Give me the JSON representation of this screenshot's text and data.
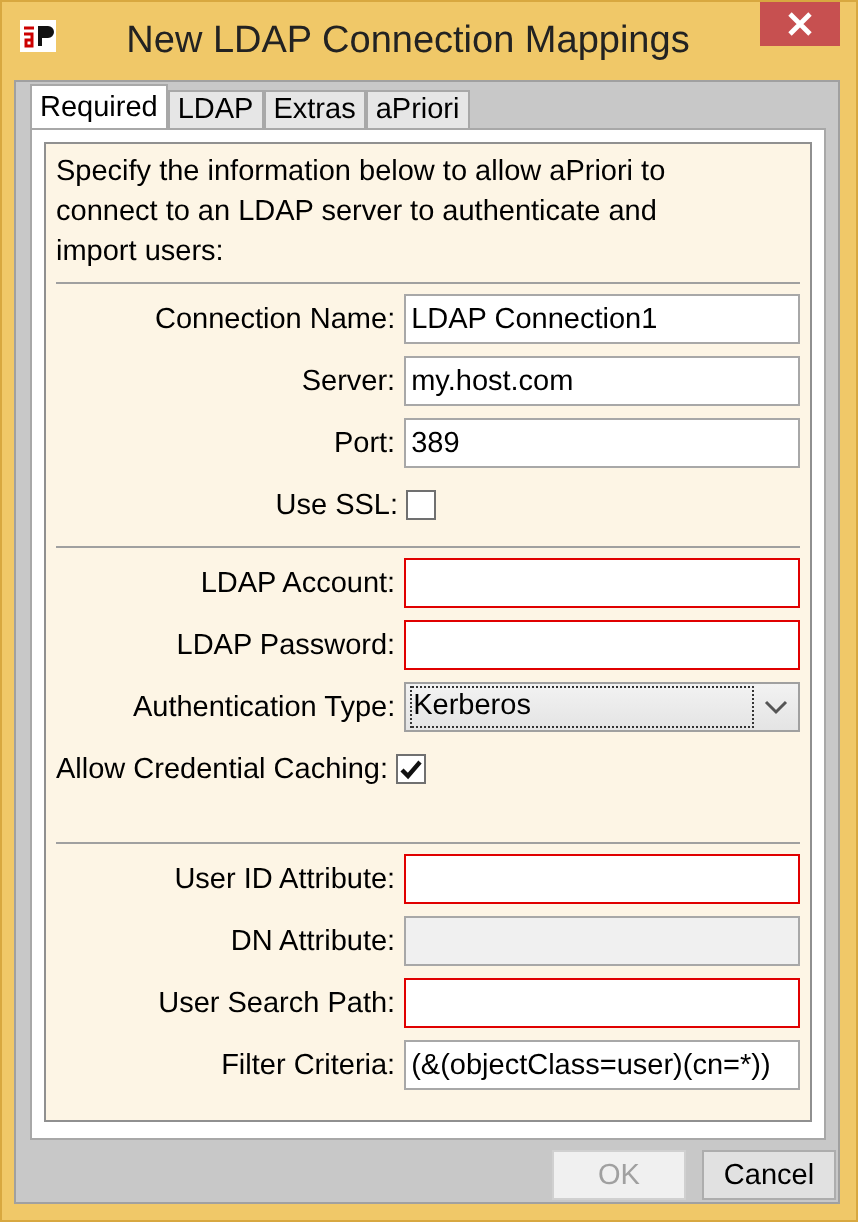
{
  "window": {
    "title": "New LDAP Connection Mappings"
  },
  "tabs": [
    {
      "label": "Required",
      "selected": true
    },
    {
      "label": "LDAP",
      "selected": false
    },
    {
      "label": "Extras",
      "selected": false
    },
    {
      "label": "aPriori",
      "selected": false
    }
  ],
  "description": "Specify the information below to allow aPriori to connect to an LDAP server to authenticate and import users:",
  "sections": [
    {
      "fields": [
        {
          "kind": "text",
          "label": "Connection Name:",
          "value": "LDAP Connection1",
          "invalid": false,
          "disabled": false
        },
        {
          "kind": "text",
          "label": "Server:",
          "value": "my.host.com",
          "invalid": false,
          "disabled": false
        },
        {
          "kind": "text",
          "label": "Port:",
          "value": "389",
          "invalid": false,
          "disabled": false
        },
        {
          "kind": "checkbox",
          "label": "Use SSL:",
          "checked": false
        }
      ]
    },
    {
      "fields": [
        {
          "kind": "text",
          "label": "LDAP Account:",
          "invalid": true,
          "disabled": false
        },
        {
          "kind": "text",
          "label": "LDAP Password:",
          "invalid": true,
          "disabled": false
        },
        {
          "kind": "select",
          "label": "Authentication Type:",
          "value": "Kerberos"
        },
        {
          "kind": "checkbox",
          "label": "Allow Credential Caching:",
          "checked": true
        }
      ]
    },
    {
      "fields": [
        {
          "kind": "text",
          "label": "User ID Attribute:",
          "invalid": true,
          "disabled": false
        },
        {
          "kind": "text",
          "label": "DN Attribute:",
          "invalid": false,
          "disabled": true
        },
        {
          "kind": "text",
          "label": "User Search Path:",
          "invalid": true,
          "disabled": false
        },
        {
          "kind": "text",
          "label": "Filter Criteria:",
          "value": "(&(objectClass=user)(cn=*))",
          "invalid": false,
          "disabled": false
        }
      ]
    }
  ],
  "buttons": [
    {
      "label": "OK",
      "disabled": true
    },
    {
      "label": "Cancel",
      "disabled": false
    }
  ]
}
